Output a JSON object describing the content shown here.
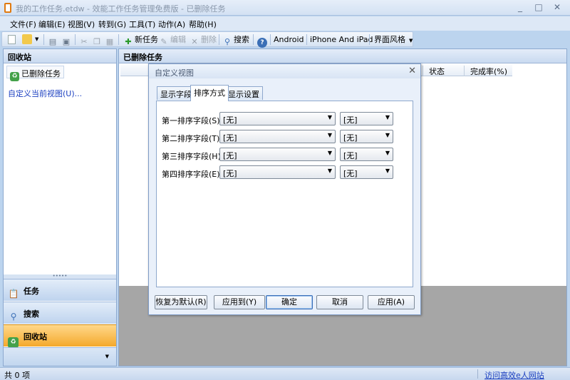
{
  "window": {
    "title": "我的工作任务.etdw - 效能工作任务管理免费版 - 已删除任务",
    "minimize": "_",
    "maximize": "□",
    "close": "✕"
  },
  "menu": [
    "文件(F)",
    "编辑(E)",
    "视图(V)",
    "转到(G)",
    "工具(T)",
    "动作(A)",
    "帮助(H)"
  ],
  "toolbar": {
    "new_task": "新任务",
    "edit": "编辑",
    "delete": "删除",
    "search": "搜索",
    "android": "Android",
    "iphone": "iPhone And iPad",
    "theme": "界面风格"
  },
  "left": {
    "header": "回收站",
    "tree_item": "已删除任务",
    "custom_view_link": "自定义当前视图(U)...",
    "nav": {
      "tasks": "任务",
      "search": "搜索",
      "recycle": "回收站"
    }
  },
  "right": {
    "header": "已删除任务",
    "columns": [
      "状态",
      "完成率(%)"
    ]
  },
  "status": {
    "count": "共 0 项",
    "link": "访问高效e人网站"
  },
  "dialog": {
    "title": "自定义视图",
    "tabs": [
      "显示字段",
      "排序方式",
      "显示设置"
    ],
    "active_tab": "排序方式",
    "rows": [
      {
        "label": "第一排序字段(S):",
        "field": "[无]",
        "order": "[无]"
      },
      {
        "label": "第二排序字段(T):",
        "field": "[无]",
        "order": "[无]"
      },
      {
        "label": "第三排序字段(H):",
        "field": "[无]",
        "order": "[无]"
      },
      {
        "label": "第四排序字段(E):",
        "field": "[无]",
        "order": "[无]"
      }
    ],
    "buttons": {
      "restore": "恢复为默认(R)",
      "apply_to": "应用到(Y)",
      "ok": "确定",
      "cancel": "取消",
      "apply": "应用(A)"
    }
  }
}
